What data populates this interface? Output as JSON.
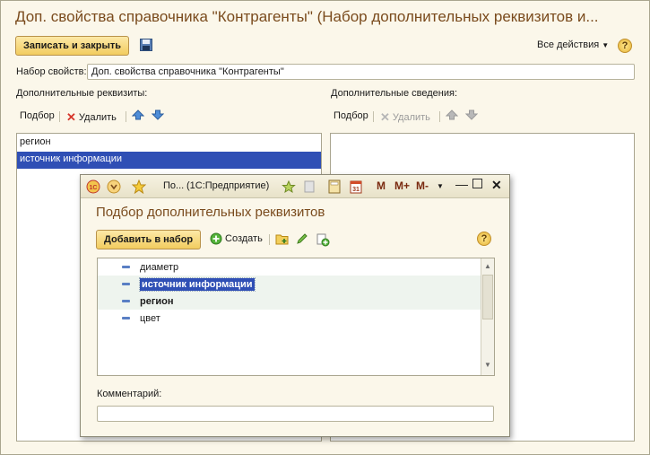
{
  "main": {
    "title": "Доп. свойства справочника \"Контрагенты\" (Набор дополнительных реквизитов и...",
    "save_close": "Записать и закрыть",
    "all_actions": "Все действия",
    "help": "?",
    "set_label": "Набор свойств:",
    "set_value": "Доп. свойства справочника \"Контрагенты\"",
    "left": {
      "heading": "Дополнительные реквизиты:",
      "pick": "Подбор",
      "delete": "Удалить",
      "items": [
        "регион",
        "источник информации"
      ]
    },
    "right": {
      "heading": "Дополнительные сведения:",
      "pick": "Подбор",
      "delete": "Удалить"
    }
  },
  "dialog": {
    "tab_title": "По...",
    "app_name": "(1С:Предприятие)",
    "toolbar_m": "M",
    "toolbar_mplus": "M+",
    "toolbar_mminus": "M-",
    "title": "Подбор дополнительных реквизитов",
    "add_button": "Добавить в набор",
    "create": "Создать",
    "help": "?",
    "rows": [
      {
        "text": "диаметр",
        "bold": false,
        "selected": false
      },
      {
        "text": "источник информации",
        "bold": true,
        "selected": true
      },
      {
        "text": "регион",
        "bold": true,
        "selected": false
      },
      {
        "text": "цвет",
        "bold": false,
        "selected": false
      }
    ],
    "comment_label": "Комментарий:",
    "comment_value": ""
  },
  "colors": {
    "accent_title": "#7a4b1d",
    "selection": "#2f4fb5",
    "button": "#f2cc5f"
  }
}
